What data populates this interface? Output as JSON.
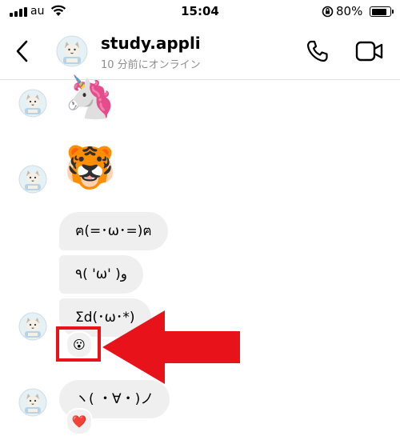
{
  "status_bar": {
    "carrier": "au",
    "time": "15:04",
    "battery_percent": "80%",
    "battery_level": 0.8
  },
  "header": {
    "name": "study.appli",
    "status": "10 分前にオンライン",
    "icons": [
      "chevron-left-icon",
      "phone-icon",
      "video-camera-icon"
    ]
  },
  "messages": [
    {
      "type": "emoji",
      "text": "🦄"
    },
    {
      "type": "emoji",
      "text": "🐯"
    },
    {
      "type": "text",
      "text": "ฅ(=･ω･=)ฅ"
    },
    {
      "type": "text",
      "text": "٩( 'ω' )و"
    },
    {
      "type": "text",
      "text": "Σd(･ω･*)",
      "reaction": "😮"
    },
    {
      "type": "text",
      "text": "ヽ( ・∀・)ノ",
      "reaction": "❤️"
    }
  ],
  "annotation": {
    "highlight_color": "#e8131a",
    "target": "reaction-emoji"
  }
}
